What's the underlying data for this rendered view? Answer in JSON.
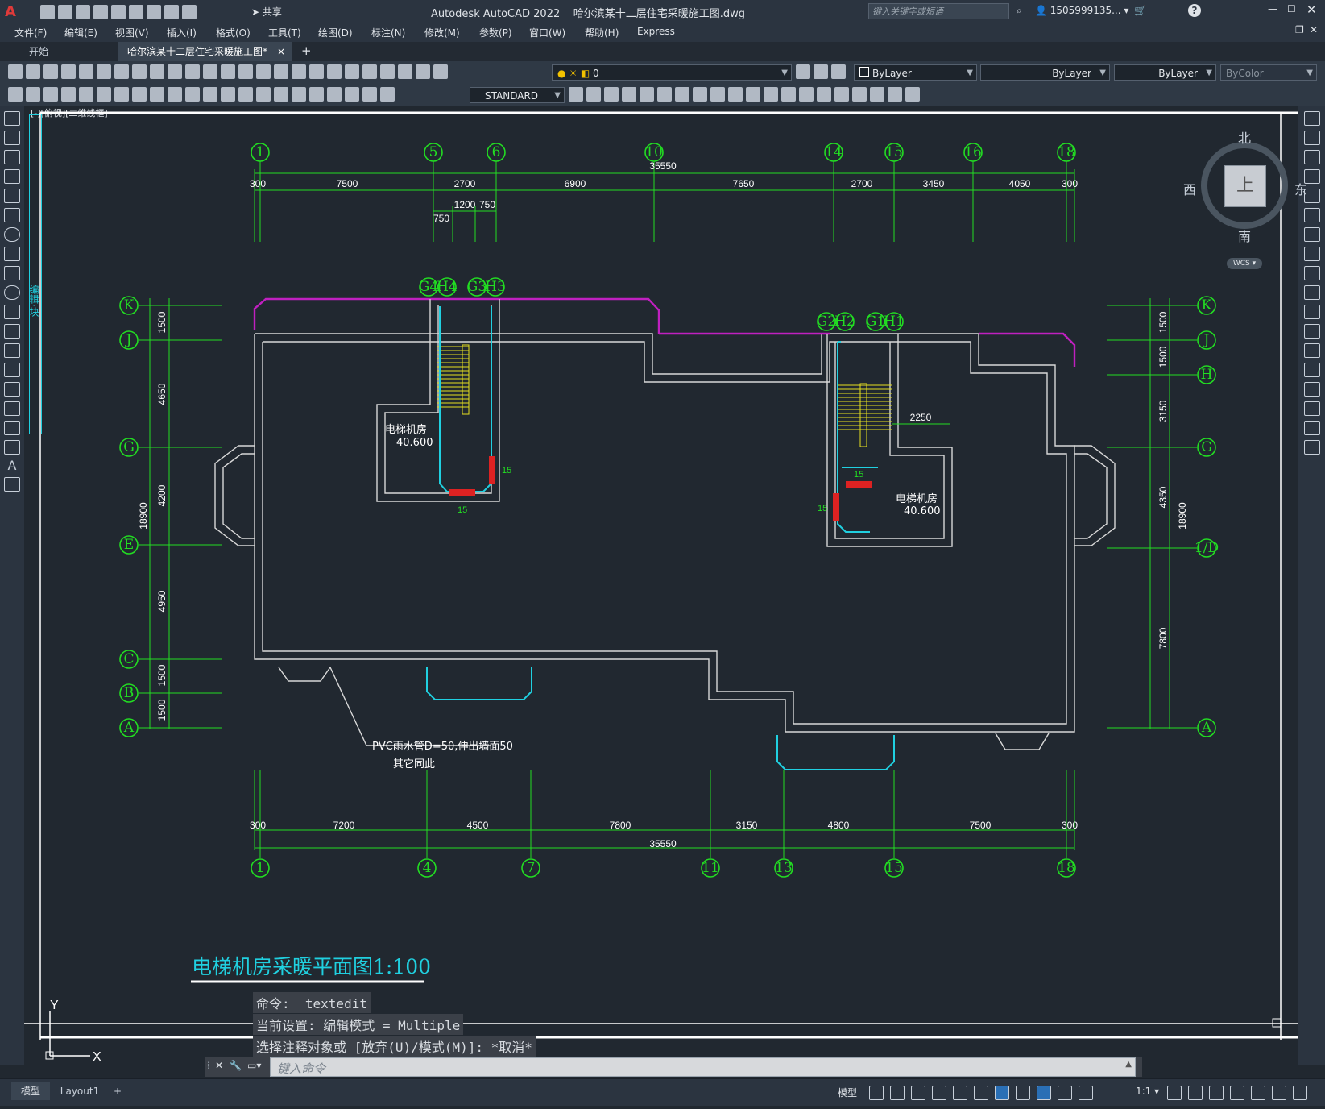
{
  "titlebar": {
    "app_title": "Autodesk AutoCAD 2022",
    "file_name": "哈尔滨某十二层住宅采暖施工图.dwg",
    "share_label": "共享",
    "search_placeholder": "键入关键字或短语",
    "user": "1505999135...",
    "help": "?"
  },
  "menu": [
    "文件(F)",
    "编辑(E)",
    "视图(V)",
    "插入(I)",
    "格式(O)",
    "工具(T)",
    "绘图(D)",
    "标注(N)",
    "修改(M)",
    "参数(P)",
    "窗口(W)",
    "帮助(H)",
    "Express"
  ],
  "tabs": {
    "start": "开始",
    "active": "哈尔滨某十二层住宅采暖施工图*",
    "close": "×",
    "add": "+"
  },
  "layers": {
    "layer_name": "0",
    "color": "ByLayer",
    "linetype": "ByLayer",
    "lineweight": "ByLayer",
    "plotstyle": "ByColor",
    "text_style": "STANDARD"
  },
  "viewport_label": "[-][俯视][二维线框]",
  "viewcube": {
    "north": "北",
    "south": "南",
    "east": "东",
    "west": "西",
    "face": "上",
    "wcs": "WCS"
  },
  "left_palette_text": "编辑·块",
  "drawing": {
    "top_axes": [
      "1",
      "5",
      "6",
      "10",
      "14",
      "15",
      "16",
      "18"
    ],
    "top_total": "35550",
    "top_dims": [
      "300",
      "7500",
      "2700",
      "6900",
      "7650",
      "2700",
      "3450",
      "4050",
      "300"
    ],
    "top_sub_dims": [
      "1200",
      "750",
      "750"
    ],
    "bottom_axes": [
      "1",
      "4",
      "7",
      "11",
      "13",
      "15",
      "18"
    ],
    "bottom_total": "35550",
    "bottom_dims": [
      "300",
      "7200",
      "4500",
      "7800",
      "3150",
      "4800",
      "7500",
      "300"
    ],
    "left_axes": [
      "K",
      "J",
      "G",
      "E",
      "C",
      "B",
      "A"
    ],
    "left_dims": [
      "1500",
      "4650",
      "4200",
      "4950",
      "1500",
      "1500"
    ],
    "left_total": "18900",
    "right_axes": [
      "K",
      "J",
      "H",
      "G",
      "1/D",
      "A"
    ],
    "right_dims": [
      "1500",
      "1500",
      "3150",
      "4350",
      "7800"
    ],
    "right_total": "18900",
    "riser_tags_left": [
      "G4",
      "H4",
      "G3",
      "H3"
    ],
    "riser_tags_right": [
      "G2",
      "H2",
      "G1",
      "H1"
    ],
    "room_left": {
      "name": "电梯机房",
      "elev": "40.600"
    },
    "room_right": {
      "name": "电梯机房",
      "elev": "40.600"
    },
    "dim_2250": "2250",
    "radiator_count": "15",
    "note_line1": "PVC雨水管D=50,伸出墙面50",
    "note_line2": "其它同此",
    "title": "电梯机房采暖平面图1:100"
  },
  "ucs": {
    "x": "X",
    "y": "Y"
  },
  "command_history": [
    "命令: _textedit",
    "当前设置: 编辑模式 = Multiple",
    "选择注释对象或 [放弃(U)/模式(M)]: *取消*"
  ],
  "command_input_placeholder": "键入命令",
  "layout_tabs": [
    "模型",
    "Layout1",
    "+"
  ],
  "status": {
    "model": "模型",
    "scale": "1:1"
  }
}
